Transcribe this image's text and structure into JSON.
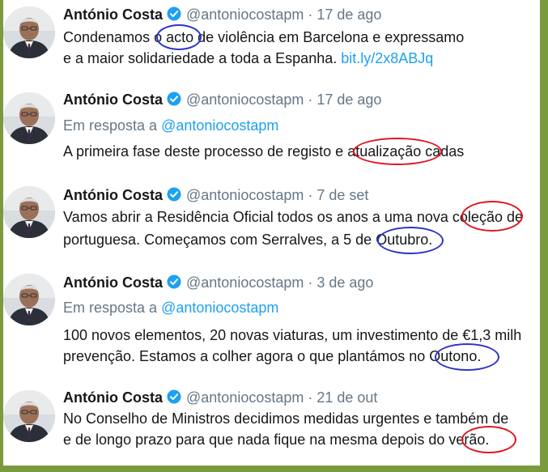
{
  "tweets": [
    {
      "name": "António Costa",
      "handle": "@antoniocostapm",
      "date": "· 17 de ago",
      "lines": [
        {
          "pre": "Condenamos o ",
          "hl": "acto",
          "post": " de violência em Barcelona e expressamo"
        },
        {
          "pre": "e a maior solidariedade a toda a Espanha.  ",
          "link": "bit.ly/2x8ABJq"
        }
      ]
    },
    {
      "name": "António Costa",
      "handle": "@antoniocostapm",
      "date": "· 17 de ago",
      "reply_prefix": "Em resposta a ",
      "reply_handle": "@antoniocostapm",
      "lines": [
        {
          "pre": "A primeira fase deste processo de registo e ",
          "hl": "atualização",
          "post": " cadas"
        }
      ]
    },
    {
      "name": "António Costa",
      "handle": "@antoniocostapm",
      "date": "· 7 de set",
      "lines": [
        {
          "pre": "Vamos abrir a Residência Oficial todos os anos a uma nova ",
          "hl": "coleção",
          "post": " de"
        },
        {
          "pre": "portuguesa. Começamos com Serralves, a 5 de ",
          "hl": "Outubro",
          "post": "."
        }
      ]
    },
    {
      "name": "António Costa",
      "handle": "@antoniocostapm",
      "date": "· 3 de ago",
      "reply_prefix": "Em resposta a ",
      "reply_handle": "@antoniocostapm",
      "lines": [
        {
          "pre": "100 novos elementos, 20 novas viaturas, um investimento de €1,3 milh"
        },
        {
          "pre": "prevenção. Estamos a colher agora o que plantámos no ",
          "hl": "Outono",
          "post": "."
        }
      ]
    },
    {
      "name": "António Costa",
      "handle": "@antoniocostapm",
      "date": "· 21 de out",
      "lines": [
        {
          "pre": "No Conselho de Ministros decidimos medidas urgentes e também de"
        },
        {
          "pre": "e de longo prazo para que nada fique na mesma depois do ",
          "hl": "verão",
          "post": "."
        }
      ]
    }
  ],
  "highlight_colors": {
    "red": "#e0141e",
    "blue": "#2b34c9"
  }
}
